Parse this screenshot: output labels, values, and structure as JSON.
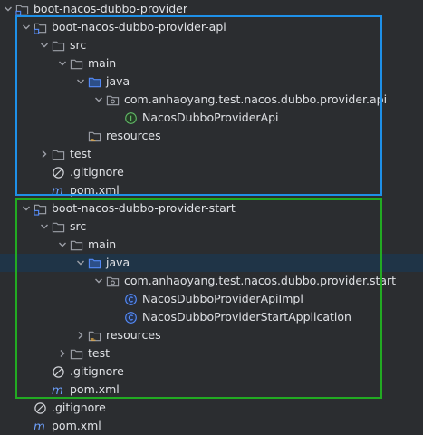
{
  "tree": [
    {
      "label": "boot-nacos-dubbo-provider",
      "icon": "module-folder-icon",
      "expand": "expanded",
      "depth": 0
    },
    {
      "label": "boot-nacos-dubbo-provider-api",
      "icon": "module-folder-icon",
      "expand": "expanded",
      "depth": 1
    },
    {
      "label": "src",
      "icon": "folder-icon",
      "expand": "expanded",
      "depth": 2
    },
    {
      "label": "main",
      "icon": "folder-icon",
      "expand": "expanded",
      "depth": 3
    },
    {
      "label": "java",
      "icon": "source-folder-icon",
      "expand": "expanded",
      "depth": 4
    },
    {
      "label": "com.anhaoyang.test.nacos.dubbo.provider.api",
      "icon": "package-icon",
      "expand": "expanded",
      "depth": 5
    },
    {
      "label": "NacosDubboProviderApi",
      "icon": "interface-icon",
      "expand": "none",
      "depth": 6
    },
    {
      "label": "resources",
      "icon": "resources-folder-icon",
      "expand": "none",
      "depth": 4
    },
    {
      "label": "test",
      "icon": "folder-icon",
      "expand": "collapsed",
      "depth": 2
    },
    {
      "label": ".gitignore",
      "icon": "ignore-file-icon",
      "expand": "none",
      "depth": 2
    },
    {
      "label": "pom.xml",
      "icon": "maven-icon",
      "expand": "none",
      "depth": 2
    },
    {
      "label": "boot-nacos-dubbo-provider-start",
      "icon": "module-folder-icon",
      "expand": "expanded",
      "depth": 1
    },
    {
      "label": "src",
      "icon": "folder-icon",
      "expand": "expanded",
      "depth": 2
    },
    {
      "label": "main",
      "icon": "folder-icon",
      "expand": "expanded",
      "depth": 3
    },
    {
      "label": "java",
      "icon": "source-folder-icon",
      "expand": "expanded",
      "depth": 4,
      "selected": true
    },
    {
      "label": "com.anhaoyang.test.nacos.dubbo.provider.start",
      "icon": "package-icon",
      "expand": "expanded",
      "depth": 5
    },
    {
      "label": "NacosDubboProviderApiImpl",
      "icon": "class-icon",
      "expand": "none",
      "depth": 6
    },
    {
      "label": "NacosDubboProviderStartApplication",
      "icon": "class-icon",
      "expand": "none",
      "depth": 6
    },
    {
      "label": "resources",
      "icon": "resources-folder-icon",
      "expand": "collapsed",
      "depth": 4
    },
    {
      "label": "test",
      "icon": "folder-icon",
      "expand": "collapsed",
      "depth": 3
    },
    {
      "label": ".gitignore",
      "icon": "ignore-file-icon",
      "expand": "none",
      "depth": 2
    },
    {
      "label": "pom.xml",
      "icon": "maven-icon",
      "expand": "none",
      "depth": 2
    },
    {
      "label": ".gitignore",
      "icon": "ignore-file-icon",
      "expand": "none",
      "depth": 1
    },
    {
      "label": "pom.xml",
      "icon": "maven-icon",
      "expand": "none",
      "depth": 1
    }
  ],
  "colors": {
    "background": "#2b2d30",
    "selected_row": "#1f3447",
    "api_module_box": "#1e90e8",
    "start_module_box": "#22aa22",
    "folder_icon": "#9da0a8",
    "source_folder_icon": "#548af7",
    "interface_icon": "#5fb865",
    "class_icon": "#548af7",
    "maven_icon": "#6c9ef8"
  }
}
